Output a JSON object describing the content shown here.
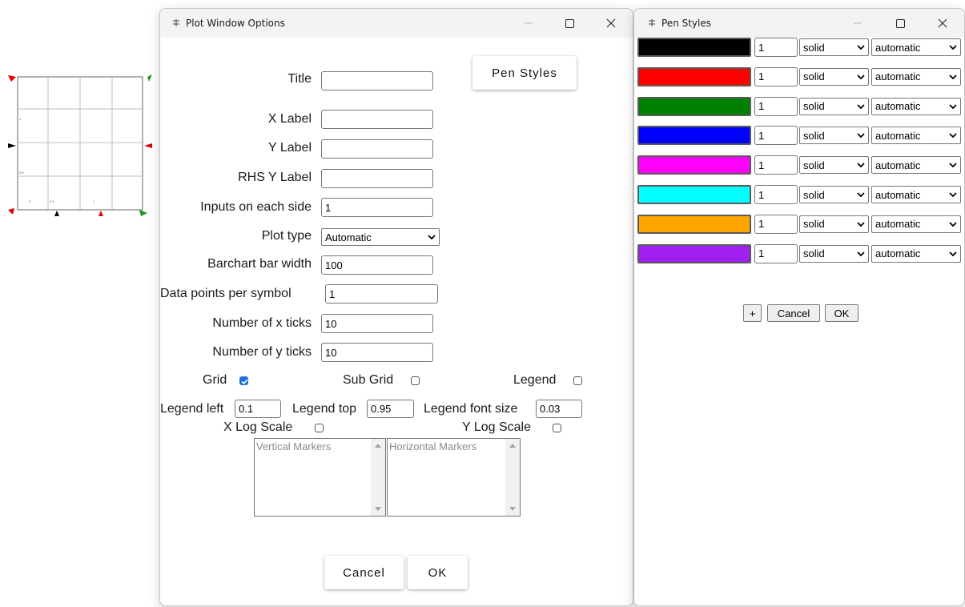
{
  "plot_options": {
    "window_title": "Plot Window Options",
    "pen_styles_button": "Pen Styles",
    "fields": {
      "title": {
        "label": "Title",
        "value": ""
      },
      "x_label": {
        "label": "X Label",
        "value": ""
      },
      "y_label": {
        "label": "Y Label",
        "value": ""
      },
      "rhs_y_label": {
        "label": "RHS Y Label",
        "value": ""
      },
      "inputs_each_side": {
        "label": "Inputs on each side",
        "value": "1"
      },
      "plot_type": {
        "label": "Plot type",
        "value": "Automatic"
      },
      "barchart_width": {
        "label": "Barchart bar width",
        "value": "100"
      },
      "points_per_symbol": {
        "label": "Data points per symbol",
        "value": "1"
      },
      "x_ticks": {
        "label": "Number of x ticks",
        "value": "10"
      },
      "y_ticks": {
        "label": "Number of y ticks",
        "value": "10"
      }
    },
    "checkboxes": {
      "grid": {
        "label": "Grid",
        "checked": true
      },
      "sub_grid": {
        "label": "Sub Grid",
        "checked": false
      },
      "legend": {
        "label": "Legend",
        "checked": false
      },
      "x_log": {
        "label": "X Log Scale",
        "checked": false
      },
      "y_log": {
        "label": "Y Log Scale",
        "checked": false
      }
    },
    "legend_left": {
      "label": "Legend left",
      "value": "0.1"
    },
    "legend_top": {
      "label": "Legend top",
      "value": "0.95"
    },
    "legend_font_size": {
      "label": "Legend font size",
      "value": "0.03"
    },
    "vertical_markers": "Vertical Markers",
    "horizontal_markers": "Horizontal Markers",
    "cancel": "Cancel",
    "ok": "OK"
  },
  "pen_styles": {
    "window_title": "Pen Styles",
    "pens": [
      {
        "color": "#000000",
        "width": "1",
        "style": "solid",
        "mode": "automatic"
      },
      {
        "color": "#ff0000",
        "width": "1",
        "style": "solid",
        "mode": "automatic"
      },
      {
        "color": "#008000",
        "width": "1",
        "style": "solid",
        "mode": "automatic"
      },
      {
        "color": "#0000ff",
        "width": "1",
        "style": "solid",
        "mode": "automatic"
      },
      {
        "color": "#ff00ff",
        "width": "1",
        "style": "solid",
        "mode": "automatic"
      },
      {
        "color": "#00ffff",
        "width": "1",
        "style": "solid",
        "mode": "automatic"
      },
      {
        "color": "#ffa500",
        "width": "1",
        "style": "solid",
        "mode": "automatic"
      },
      {
        "color": "#a020f0",
        "width": "1",
        "style": "solid",
        "mode": "automatic"
      }
    ],
    "add": "+",
    "cancel": "Cancel",
    "ok": "OK"
  },
  "plot_widget": {
    "ytick_labels": [
      "1",
      "0.5"
    ],
    "xtick_labels": [
      "0",
      "0.5",
      "1"
    ]
  }
}
